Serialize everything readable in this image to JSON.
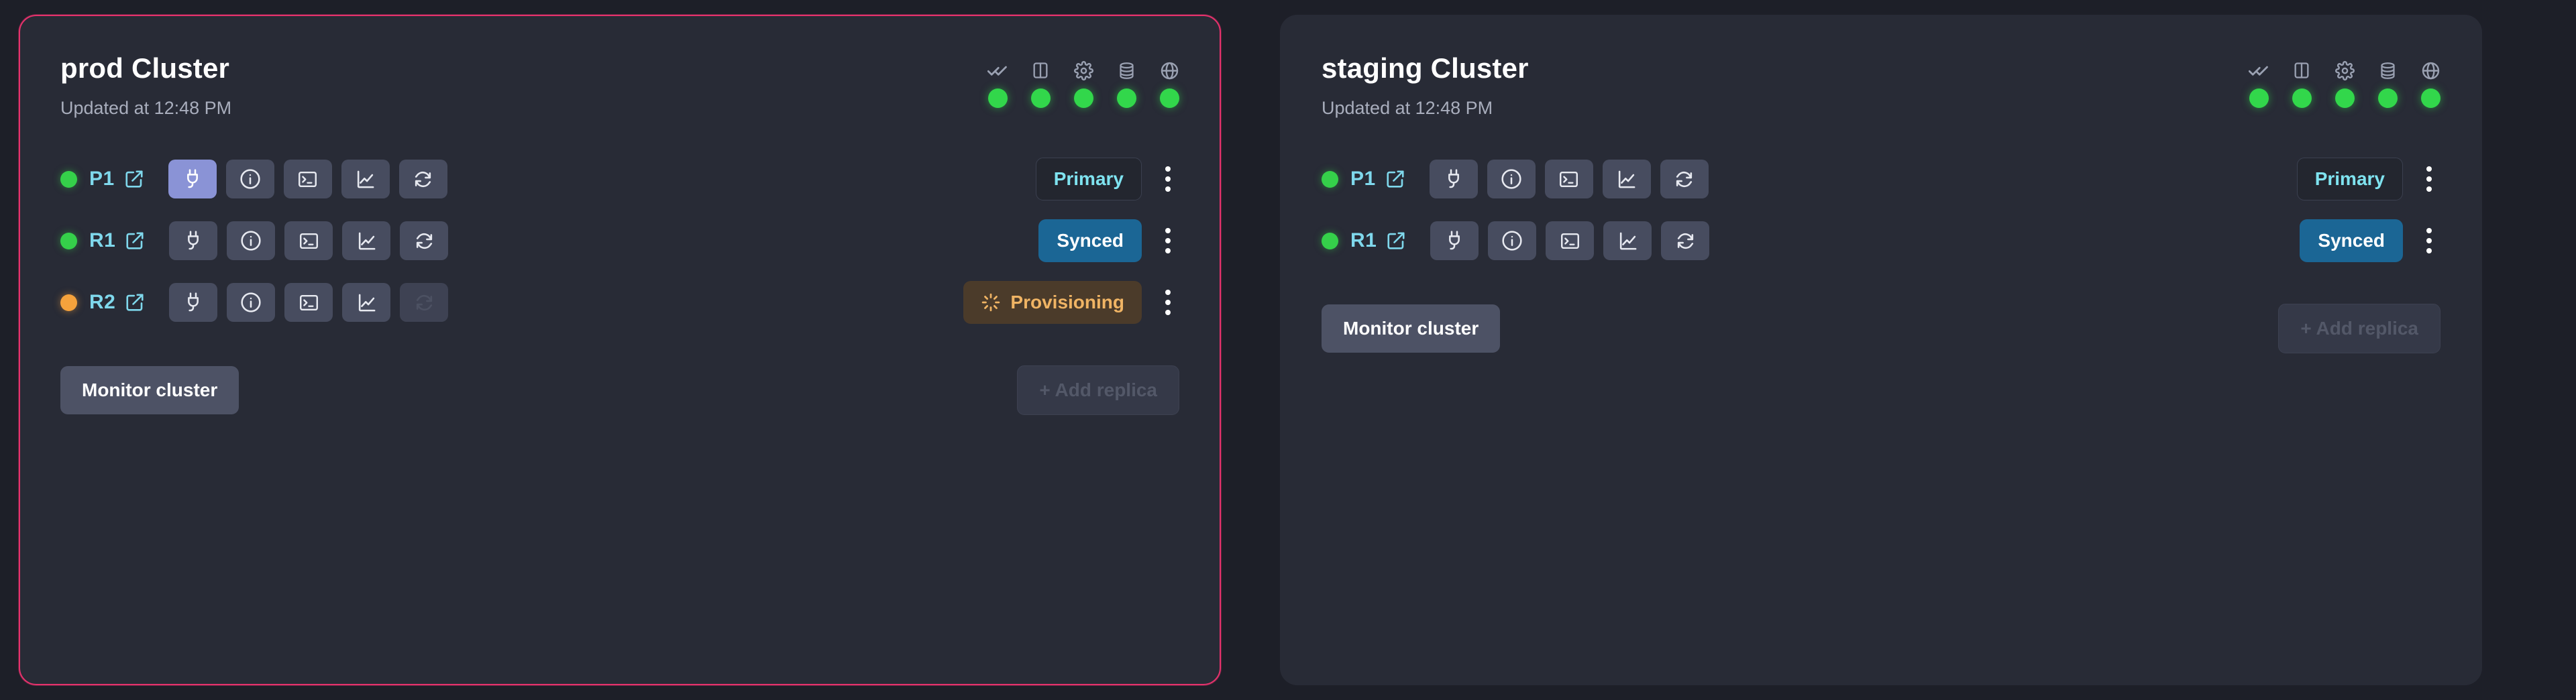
{
  "colors": {
    "page_bg": "#1d1f28",
    "card_bg": "#282b36",
    "selected_border": "#e5326c",
    "status_ok": "#32d74b",
    "status_warn": "#f5a23c",
    "node_accent": "#7fd8ec",
    "active_btn": "#8a93d6",
    "synced_bg": "#1b6695",
    "provisioning_fg": "#f0b464"
  },
  "cards": [
    {
      "title": "prod Cluster",
      "updated": "Updated at 12:48 PM",
      "selected": true,
      "health": [
        {
          "icon": "check-check-icon",
          "state": "ok"
        },
        {
          "icon": "panel-icon",
          "state": "ok"
        },
        {
          "icon": "cog-icon",
          "state": "ok"
        },
        {
          "icon": "database-icon",
          "state": "ok"
        },
        {
          "icon": "globe-icon",
          "state": "ok"
        }
      ],
      "rows": [
        {
          "node": "P1",
          "dot": "ok",
          "actions": [
            {
              "icon": "plug-icon",
              "state": "active"
            },
            {
              "icon": "info-icon",
              "state": "normal"
            },
            {
              "icon": "terminal-icon",
              "state": "normal"
            },
            {
              "icon": "line-chart-icon",
              "state": "normal"
            },
            {
              "icon": "refresh-icon",
              "state": "normal"
            }
          ],
          "badge": {
            "label": "Primary",
            "kind": "primary",
            "spinner": false
          }
        },
        {
          "node": "R1",
          "dot": "ok",
          "actions": [
            {
              "icon": "plug-icon",
              "state": "normal"
            },
            {
              "icon": "info-icon",
              "state": "normal"
            },
            {
              "icon": "terminal-icon",
              "state": "normal"
            },
            {
              "icon": "line-chart-icon",
              "state": "normal"
            },
            {
              "icon": "refresh-icon",
              "state": "normal"
            }
          ],
          "badge": {
            "label": "Synced",
            "kind": "synced",
            "spinner": false
          }
        },
        {
          "node": "R2",
          "dot": "warn",
          "actions": [
            {
              "icon": "plug-icon",
              "state": "normal"
            },
            {
              "icon": "info-icon",
              "state": "normal"
            },
            {
              "icon": "terminal-icon",
              "state": "normal"
            },
            {
              "icon": "line-chart-icon",
              "state": "normal"
            },
            {
              "icon": "refresh-icon",
              "state": "disabled"
            }
          ],
          "badge": {
            "label": "Provisioning",
            "kind": "provisioning",
            "spinner": true
          }
        }
      ],
      "footer": {
        "monitor_label": "Monitor cluster",
        "add_label": "+ Add replica",
        "add_disabled": true
      }
    },
    {
      "title": "staging Cluster",
      "updated": "Updated at 12:48 PM",
      "selected": false,
      "health": [
        {
          "icon": "check-check-icon",
          "state": "ok"
        },
        {
          "icon": "panel-icon",
          "state": "ok"
        },
        {
          "icon": "cog-icon",
          "state": "ok"
        },
        {
          "icon": "database-icon",
          "state": "ok"
        },
        {
          "icon": "globe-icon",
          "state": "ok"
        }
      ],
      "rows": [
        {
          "node": "P1",
          "dot": "ok",
          "actions": [
            {
              "icon": "plug-icon",
              "state": "normal"
            },
            {
              "icon": "info-icon",
              "state": "normal"
            },
            {
              "icon": "terminal-icon",
              "state": "normal"
            },
            {
              "icon": "line-chart-icon",
              "state": "normal"
            },
            {
              "icon": "refresh-icon",
              "state": "normal"
            }
          ],
          "badge": {
            "label": "Primary",
            "kind": "primary",
            "spinner": false
          }
        },
        {
          "node": "R1",
          "dot": "ok",
          "actions": [
            {
              "icon": "plug-icon",
              "state": "normal"
            },
            {
              "icon": "info-icon",
              "state": "normal"
            },
            {
              "icon": "terminal-icon",
              "state": "normal"
            },
            {
              "icon": "line-chart-icon",
              "state": "normal"
            },
            {
              "icon": "refresh-icon",
              "state": "normal"
            }
          ],
          "badge": {
            "label": "Synced",
            "kind": "synced",
            "spinner": false
          }
        }
      ],
      "footer": {
        "monitor_label": "Monitor cluster",
        "add_label": "+ Add replica",
        "add_disabled": true
      }
    }
  ]
}
